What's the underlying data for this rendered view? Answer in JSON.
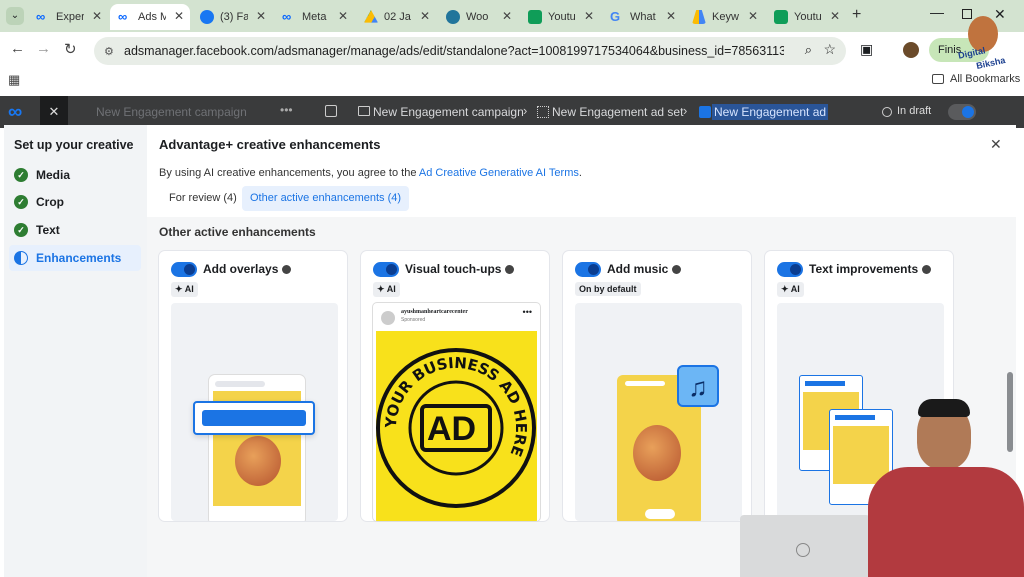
{
  "browser": {
    "tabs": [
      {
        "label": "Exper",
        "color": "#0866ff"
      },
      {
        "label": "Ads M",
        "color": "#0866ff"
      },
      {
        "label": "(3) Fa",
        "color": "#1877f2"
      },
      {
        "label": "Meta",
        "color": "#0866ff"
      },
      {
        "label": "02 Ja",
        "color": "#fbbc04"
      },
      {
        "label": "Woo",
        "color": "#21759b"
      },
      {
        "label": "Youtu",
        "color": "#0f9d58"
      },
      {
        "label": "What",
        "color": "#4285f4"
      },
      {
        "label": "Keyw",
        "color": "#4285f4"
      },
      {
        "label": "Youtu",
        "color": "#0f9d58"
      }
    ],
    "url": "adsmanager.facebook.com/adsmanager/manage/ads/edit/standalone?act=1008199717534064&business_id=785631137036741&gl...",
    "finish_label": "Finis",
    "bookmarks_label": "All Bookmarks"
  },
  "fbnav": {
    "campaign_dim": "New Engagement campaign",
    "breadcrumb": [
      "New Engagement campaign",
      "New Engagement ad set",
      "New Engagement ad"
    ],
    "status": "In draft"
  },
  "sidebar": {
    "title": "Set up your creative",
    "steps": [
      "Media",
      "Crop",
      "Text",
      "Enhancements"
    ]
  },
  "modal": {
    "title": "Advantage+ creative enhancements",
    "desc_prefix": "By using AI creative enhancements, you agree to the ",
    "desc_link": "Ad Creative Generative AI Terms",
    "desc_suffix": ".",
    "tabs": [
      "For review (4)",
      "Other active enhancements (4)"
    ],
    "section": "Other active enhancements",
    "cards": [
      {
        "title": "Add overlays",
        "badge": "AI"
      },
      {
        "title": "Visual touch-ups",
        "badge": "AI"
      },
      {
        "title": "Add music",
        "badge": "On by default"
      },
      {
        "title": "Text improvements",
        "badge": "AI"
      }
    ],
    "ad_page": "ayushmanheartcarecenter",
    "ad_sponsored": "Sponsored",
    "ad_ring": "YOUR BUSINESS AD HERE",
    "ad_center": "AD",
    "watermark_line1": "Digital",
    "watermark_line2": "Biksha"
  }
}
